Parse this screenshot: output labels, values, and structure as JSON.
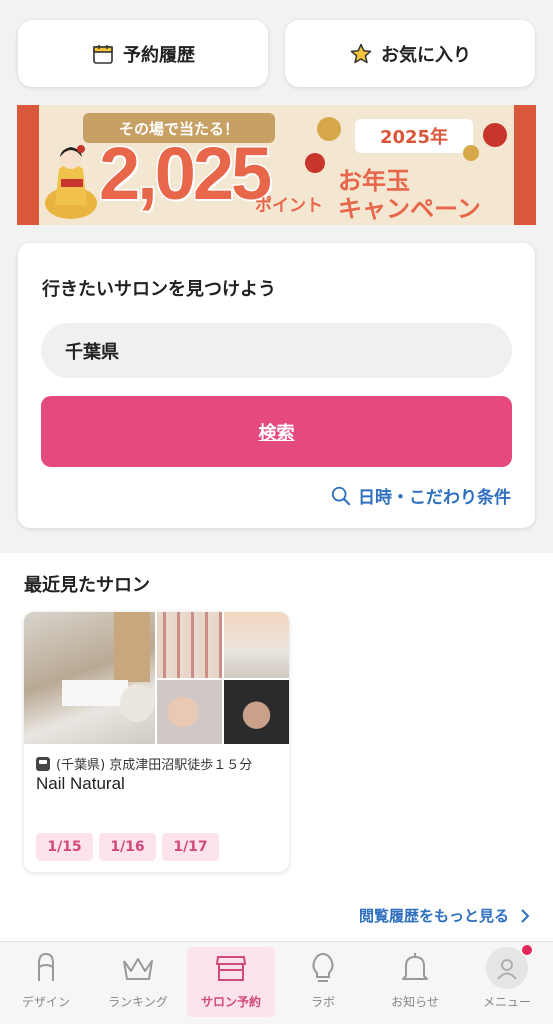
{
  "top_buttons": {
    "history_label": "予約履歴",
    "favorites_label": "お気に入り"
  },
  "banner": {
    "tagline": "その場で当たる！",
    "big_number": "2,025",
    "points_label": "ポイント",
    "year_label": "2025年",
    "campaign_line1": "お年玉",
    "campaign_line2": "キャンペーン"
  },
  "search": {
    "title": "行きたいサロンを見つけよう",
    "area_value": "千葉県",
    "button_label": "検索",
    "conditions_label": "日時・こだわり条件"
  },
  "recent": {
    "title": "最近見たサロン",
    "salons": [
      {
        "station": "(千葉県) 京成津田沼駅徒歩１５分",
        "name": "Nail Natural",
        "dates": [
          "1/15",
          "1/16",
          "1/17"
        ]
      }
    ],
    "more_label": "閲覧履歴をもっと見る"
  },
  "tabbar": {
    "items": [
      {
        "label": "デザイン",
        "icon": "nail-icon"
      },
      {
        "label": "ランキング",
        "icon": "crown-icon"
      },
      {
        "label": "サロン予約",
        "icon": "store-icon",
        "active": true
      },
      {
        "label": "ラボ",
        "icon": "lightbulb-icon"
      },
      {
        "label": "お知らせ",
        "icon": "bell-icon"
      },
      {
        "label": "メニュー",
        "icon": "avatar-icon"
      }
    ]
  },
  "colors": {
    "accent_pink": "#e44a80",
    "link_blue": "#2f6fbf",
    "chip_bg": "#fde4ec",
    "badge_red": "#e4285a"
  }
}
